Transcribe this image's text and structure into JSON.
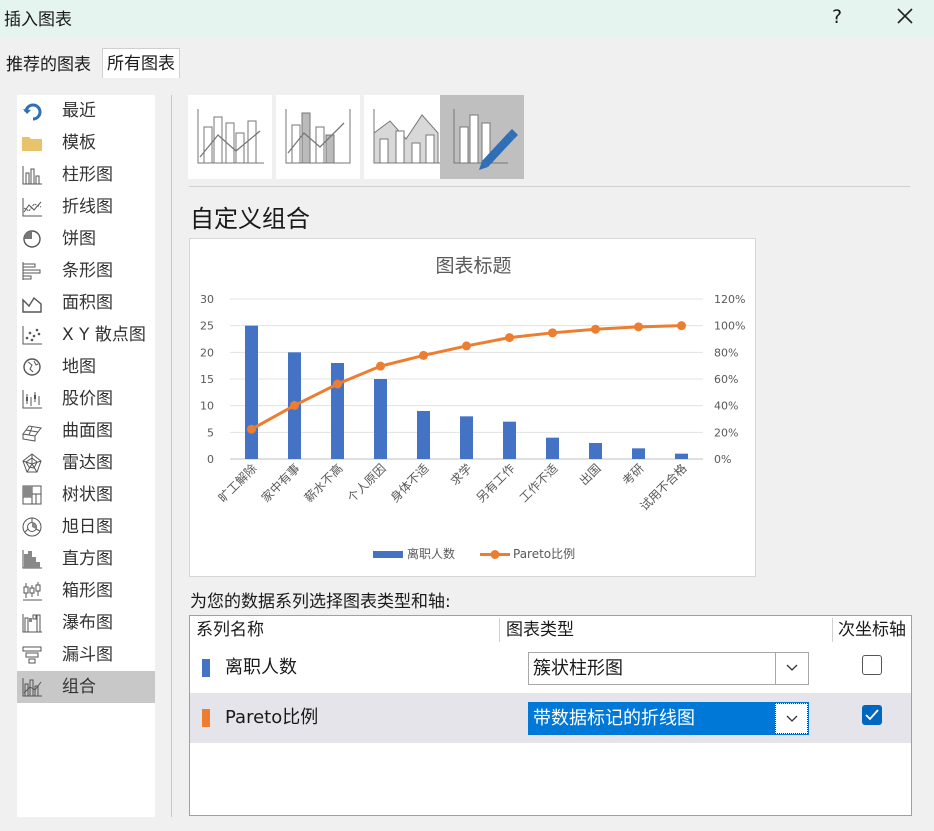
{
  "window": {
    "title": "插入图表",
    "help_glyph": "?"
  },
  "tabs": [
    {
      "label": "推荐的图表",
      "active": false
    },
    {
      "label": "所有图表",
      "active": true
    }
  ],
  "sidebar": {
    "items": [
      {
        "label": "最近",
        "icon": "recent-icon"
      },
      {
        "label": "模板",
        "icon": "folder-icon"
      },
      {
        "label": "柱形图",
        "icon": "column-chart-icon"
      },
      {
        "label": "折线图",
        "icon": "line-chart-icon"
      },
      {
        "label": "饼图",
        "icon": "pie-chart-icon"
      },
      {
        "label": "条形图",
        "icon": "bar-chart-icon"
      },
      {
        "label": "面积图",
        "icon": "area-chart-icon"
      },
      {
        "label": "X Y 散点图",
        "icon": "scatter-chart-icon"
      },
      {
        "label": "地图",
        "icon": "map-chart-icon"
      },
      {
        "label": "股价图",
        "icon": "stock-chart-icon"
      },
      {
        "label": "曲面图",
        "icon": "surface-chart-icon"
      },
      {
        "label": "雷达图",
        "icon": "radar-chart-icon"
      },
      {
        "label": "树状图",
        "icon": "treemap-chart-icon"
      },
      {
        "label": "旭日图",
        "icon": "sunburst-chart-icon"
      },
      {
        "label": "直方图",
        "icon": "histogram-chart-icon"
      },
      {
        "label": "箱形图",
        "icon": "box-whisker-chart-icon"
      },
      {
        "label": "瀑布图",
        "icon": "waterfall-chart-icon"
      },
      {
        "label": "漏斗图",
        "icon": "funnel-chart-icon"
      },
      {
        "label": "组合",
        "icon": "combo-chart-icon",
        "selected": true
      }
    ]
  },
  "subtypes": [
    "combo-clustered-column-line-icon",
    "combo-column-line-secondary-icon",
    "combo-area-column-icon",
    "custom-combo-icon"
  ],
  "main": {
    "subtitle": "自定义组合",
    "instruction": "为您的数据系列选择图表类型和轴:"
  },
  "chart_data": {
    "type": "bar",
    "title": "图表标题",
    "categories": [
      "旷工解除",
      "家中有事",
      "薪水不高",
      "个人原因",
      "身体不适",
      "求学",
      "另有工作",
      "工作不适",
      "出国",
      "考研",
      "试用不合格"
    ],
    "series": [
      {
        "name": "离职人数",
        "type": "bar",
        "axis": "primary",
        "color": "#4472c4",
        "values": [
          25,
          20,
          18,
          15,
          9,
          8,
          7,
          4,
          3,
          2,
          1
        ]
      },
      {
        "name": "Pareto比例",
        "type": "line",
        "axis": "secondary",
        "color": "#ed7d31",
        "values": [
          0.2232,
          0.4018,
          0.5625,
          0.6964,
          0.7768,
          0.8482,
          0.9107,
          0.9464,
          0.9732,
          0.9911,
          1.0
        ]
      }
    ],
    "ylim": [
      0,
      30
    ],
    "yticks": [
      "0",
      "5",
      "10",
      "15",
      "20",
      "25",
      "30"
    ],
    "y2lim": [
      0,
      1.2
    ],
    "y2ticks": [
      "0%",
      "20%",
      "40%",
      "60%",
      "80%",
      "100%",
      "120%"
    ],
    "grid": true,
    "legend": "bottom"
  },
  "series_table": {
    "headers": {
      "name": "系列名称",
      "type": "图表类型",
      "secondary": "次坐标轴"
    },
    "rows": [
      {
        "name": "离职人数",
        "chart_type": "簇状柱形图",
        "secondary": false,
        "color": "#4472c4"
      },
      {
        "name": "Pareto比例",
        "chart_type": "带数据标记的折线图",
        "secondary": true,
        "color": "#ed7d31",
        "selected": true
      }
    ]
  }
}
